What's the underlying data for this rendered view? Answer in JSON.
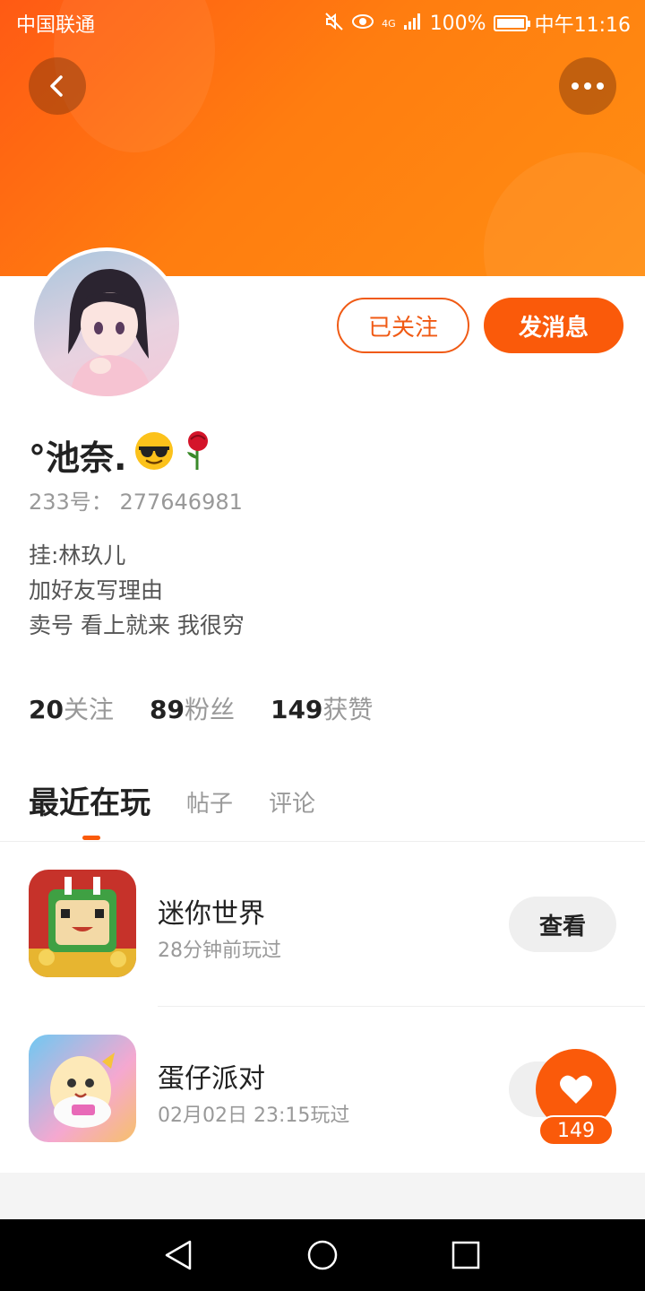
{
  "status_bar": {
    "carrier": "中国联通",
    "network": "4G",
    "battery": "100%",
    "time": "中午11:16"
  },
  "header": {
    "back_icon": "chevron-left-icon",
    "more_icon": "more-dots-icon"
  },
  "profile": {
    "name": "°池奈.",
    "name_emojis": [
      "sunglasses-emoji",
      "rose-emoji"
    ],
    "uid_label": "233号：",
    "uid": "277646981",
    "bio": [
      "挂:林玖儿",
      "加好友写理由",
      "卖号 看上就来 我很穷"
    ],
    "followed_label": "已关注",
    "message_label": "发消息"
  },
  "stats": [
    {
      "num": "20",
      "label": "关注"
    },
    {
      "num": "89",
      "label": "粉丝"
    },
    {
      "num": "149",
      "label": "获赞"
    }
  ],
  "tabs": {
    "active": "最近在玩",
    "items": [
      "帖子",
      "评论"
    ]
  },
  "games": [
    {
      "title": "迷你世界",
      "subtitle": "28分钟前玩过",
      "button": "查看"
    },
    {
      "title": "蛋仔派对",
      "subtitle": "02月02日 23:15玩过"
    }
  ],
  "like": {
    "count": "149",
    "icon": "heart-icon"
  },
  "colors": {
    "accent": "#fa5a0a",
    "header_gradient_start": "#ff5a14",
    "header_gradient_end": "#ff8e12"
  }
}
